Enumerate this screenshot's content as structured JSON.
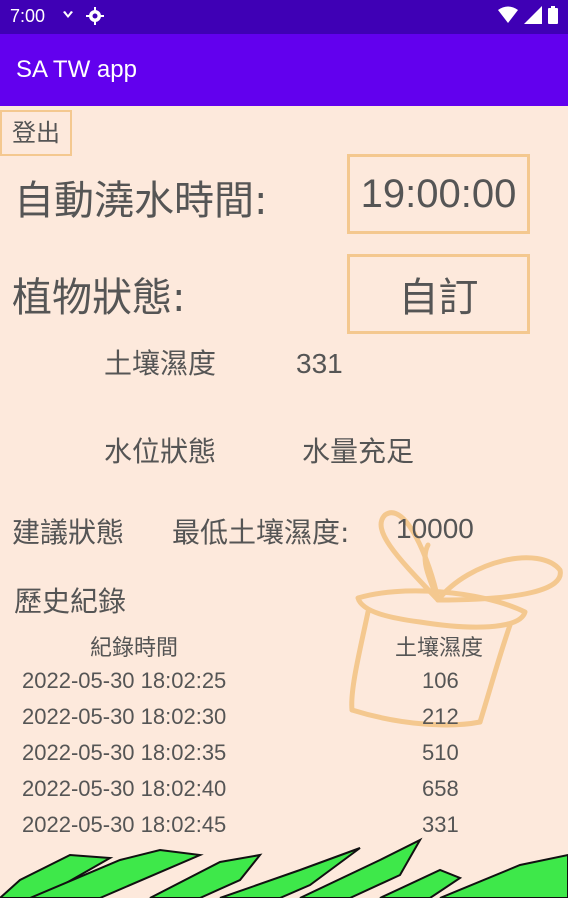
{
  "status_bar": {
    "time": "7:00",
    "icons": [
      "android-debug-icon",
      "settings-gear-icon",
      "wifi-icon",
      "cell-signal-icon",
      "battery-icon"
    ]
  },
  "app_bar": {
    "title": "SA TW app"
  },
  "logout_button": "登出",
  "watering": {
    "label": "自動澆水時間:",
    "time_value": "19:00:00"
  },
  "plant_status": {
    "label": "植物狀態:",
    "mode_value": "自訂"
  },
  "soil_moisture": {
    "label": "土壤濕度",
    "value": "331"
  },
  "water_level": {
    "label": "水位狀態",
    "value": "水量充足"
  },
  "suggestion": {
    "label": "建議狀態",
    "text": "最低土壤濕度:",
    "value": "10000"
  },
  "history": {
    "title": "歷史紀錄",
    "columns": [
      "紀錄時間",
      "土壤濕度"
    ],
    "rows": [
      {
        "time": "2022-05-30 18:02:25",
        "moisture": "106"
      },
      {
        "time": "2022-05-30 18:02:30",
        "moisture": "212"
      },
      {
        "time": "2022-05-30 18:02:35",
        "moisture": "510"
      },
      {
        "time": "2022-05-30 18:02:40",
        "moisture": "658"
      },
      {
        "time": "2022-05-30 18:02:45",
        "moisture": "331"
      }
    ]
  },
  "colors": {
    "status_bar": "#3f00b5",
    "app_bar": "#6200ee",
    "background": "#fde9dc",
    "box_border": "#f4c88f",
    "grass": "#3ee84a"
  }
}
